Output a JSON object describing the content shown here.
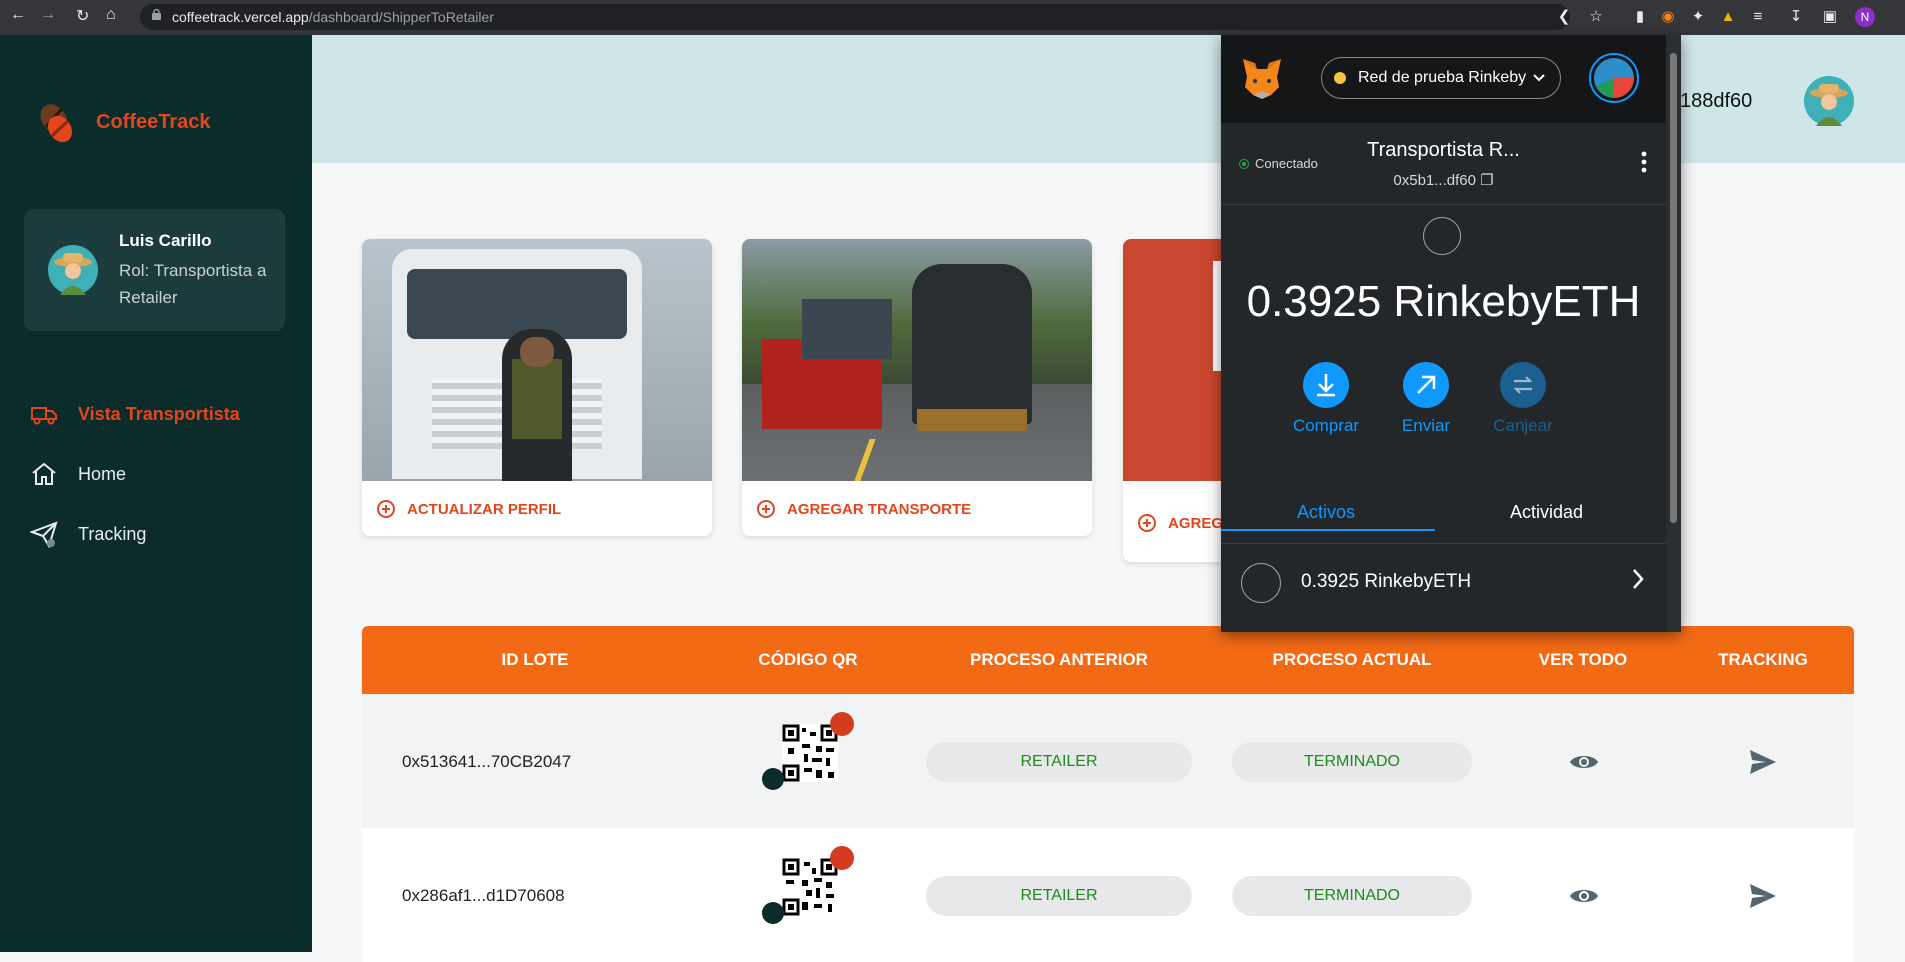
{
  "browser": {
    "url_host": "coffeetrack.vercel.app",
    "url_path": "/dashboard/ShipperToRetailer",
    "profile_initial": "N"
  },
  "sidebar": {
    "brand": "CoffeeTrack",
    "user": {
      "name": "Luis Carillo",
      "role": "Rol: Transportista a Retailer"
    },
    "items": [
      {
        "label": "Vista Transportista",
        "icon": "truck-icon",
        "active": true
      },
      {
        "label": "Home",
        "icon": "home-icon",
        "active": false
      },
      {
        "label": "Tracking",
        "icon": "paper-plane-icon",
        "active": false
      }
    ]
  },
  "topbar": {
    "address_fragment": "188df60"
  },
  "cards": [
    {
      "action": "ACTUALIZAR PERFIL"
    },
    {
      "action": "AGREGAR TRANSPORTE"
    },
    {
      "action": "AGREG"
    }
  ],
  "table": {
    "headers": [
      "ID LOTE",
      "CÓDIGO QR",
      "PROCESO ANTERIOR",
      "PROCESO ACTUAL",
      "VER TODO",
      "TRACKING"
    ],
    "rows": [
      {
        "id": "0x513641...70CB2047",
        "prev": "RETAILER",
        "curr": "TERMINADO"
      },
      {
        "id": "0x286af1...d1D70608",
        "prev": "RETAILER",
        "curr": "TERMINADO"
      }
    ]
  },
  "metamask": {
    "network": "Red de prueba Rinkeby",
    "status": "Conectado",
    "account_name": "Transportista R...",
    "account_address": "0x5b1...df60",
    "balance": "0.3925 RinkebyETH",
    "actions": [
      {
        "label": "Comprar",
        "enabled": true
      },
      {
        "label": "Enviar",
        "enabled": true
      },
      {
        "label": "Canjear",
        "enabled": false
      }
    ],
    "tabs": [
      {
        "label": "Activos",
        "active": true
      },
      {
        "label": "Actividad",
        "active": false
      }
    ],
    "asset": "0.3925 RinkebyETH"
  },
  "colors": {
    "brand": "#e3461d",
    "sidebar": "#0c2b2b",
    "table_header": "#f36a15",
    "mm_blue": "#1098fc"
  }
}
